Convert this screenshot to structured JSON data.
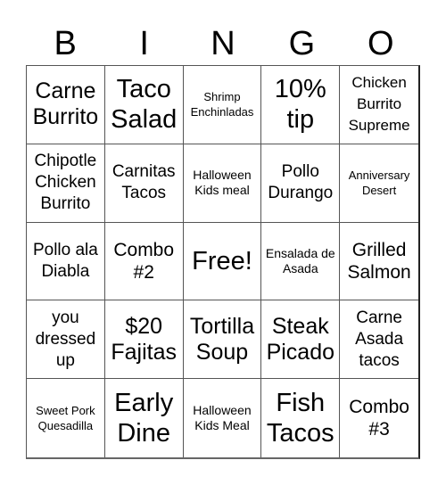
{
  "header": [
    "B",
    "I",
    "N",
    "G",
    "O"
  ],
  "cells": [
    {
      "text": "Carne Burrito",
      "size": "l"
    },
    {
      "text": "Taco Salad",
      "size": "xl"
    },
    {
      "text": "Shrimp Enchinladas",
      "size": "xxs"
    },
    {
      "text": "10% tip",
      "size": "xl"
    },
    {
      "text": "Chicken Burrito Supreme",
      "size": "s"
    },
    {
      "text": "Chipotle Chicken Burrito",
      "size": "ms"
    },
    {
      "text": "Carnitas Tacos",
      "size": "ms"
    },
    {
      "text": "Halloween Kids meal",
      "size": "xs"
    },
    {
      "text": "Pollo Durango",
      "size": "ms"
    },
    {
      "text": "Anniversary Desert",
      "size": "xxs"
    },
    {
      "text": "Pollo ala Diabla",
      "size": "ms"
    },
    {
      "text": "Combo #2",
      "size": "m"
    },
    {
      "text": "Free!",
      "size": "xl"
    },
    {
      "text": "Ensalada de Asada",
      "size": "xs"
    },
    {
      "text": "Grilled Salmon",
      "size": "m"
    },
    {
      "text": "you dressed up",
      "size": "ms"
    },
    {
      "text": "$20 Fajitas",
      "size": "l"
    },
    {
      "text": "Tortilla Soup",
      "size": "l"
    },
    {
      "text": "Steak Picado",
      "size": "l"
    },
    {
      "text": "Carne Asada tacos",
      "size": "ms"
    },
    {
      "text": "Sweet Pork Quesadilla",
      "size": "xxs"
    },
    {
      "text": "Early Dine",
      "size": "xl"
    },
    {
      "text": "Halloween Kids Meal",
      "size": "xs"
    },
    {
      "text": "Fish Tacos",
      "size": "xl"
    },
    {
      "text": "Combo #3",
      "size": "m"
    }
  ]
}
